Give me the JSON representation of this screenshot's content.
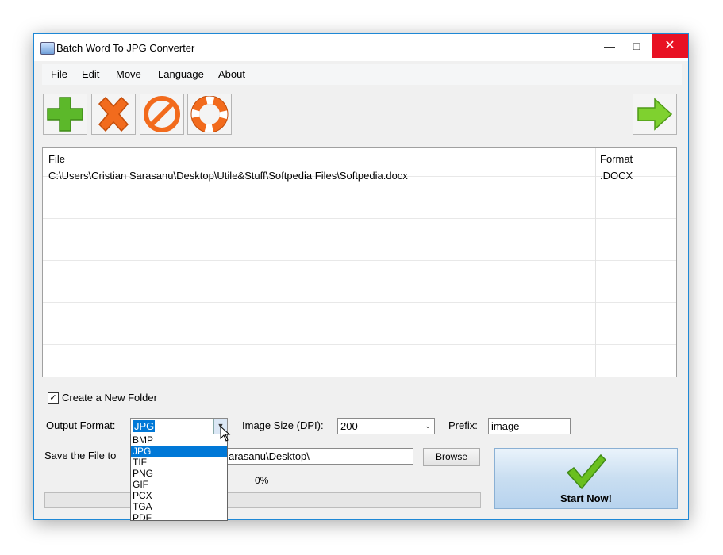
{
  "window": {
    "title": "Batch Word To JPG Converter"
  },
  "menu": [
    "File",
    "Edit",
    "Move",
    "Language",
    "About"
  ],
  "files": {
    "columns": [
      "File",
      "Format"
    ],
    "rows": [
      {
        "file": "C:\\Users\\Cristian Sarasanu\\Desktop\\Utile&Stuff\\Softpedia Files\\Softpedia.docx",
        "format": ".DOCX"
      }
    ]
  },
  "options": {
    "create_folder_label": "Create a New Folder",
    "create_folder_checked": true,
    "output_format_label": "Output Format:",
    "output_format_value": "JPG",
    "format_options": [
      "BMP",
      "JPG",
      "TIF",
      "PNG",
      "GIF",
      "PCX",
      "TGA",
      "PDF"
    ],
    "image_size_label": "Image Size (DPI):",
    "image_size_value": "200",
    "prefix_label": "Prefix:",
    "prefix_value": "image",
    "save_label": "Save the File to",
    "save_path": "arasanu\\Desktop\\",
    "browse_label": "Browse",
    "progress_text": "0%",
    "progress_fraction": 0,
    "start_label": "Start Now!"
  }
}
